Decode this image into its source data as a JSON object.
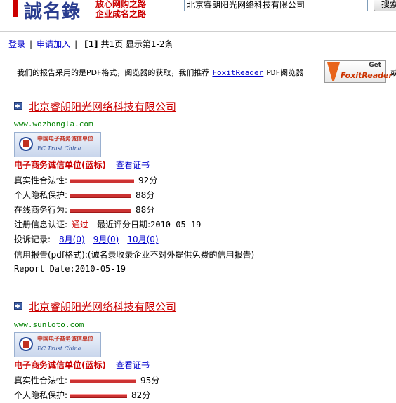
{
  "header": {
    "logo": "誠名錄",
    "slogan_line1": "放心网购之路",
    "slogan_line2": "企业成名之路",
    "search_value": "北京睿朗阳光网络科技有限公司",
    "search_button": "搜索"
  },
  "nav": {
    "login": "登录",
    "apply": "申请加入",
    "page_current": "[1]",
    "page_info": "共1页 显示第1-2条"
  },
  "notice": {
    "text_before": "我们的报告采用的是PDF格式，阅览器的获取，我们推荐",
    "link": "FoxitReader",
    "text_after": "PDF阅览器",
    "edge": "或",
    "foxit_get": "Get",
    "foxit_name": "FoxitReader"
  },
  "entries": [
    {
      "company": "北京睿朗阳光网络科技有限公司",
      "url": "www.wozhongla.com",
      "badge_cn": "中国电子商务诚信单位",
      "badge_en": "EC Trust China",
      "cert_status": "电子商务诚信单位(蓝标)",
      "cert_link": "查看证书",
      "scores": [
        {
          "label": "真实性合法性:",
          "value": "92分",
          "score": 92
        },
        {
          "label": "个人隐私保护:",
          "value": "88分",
          "score": 88
        },
        {
          "label": "在线商务行为:",
          "value": "88分",
          "score": 88
        }
      ],
      "reg_label": "注册信息认证:",
      "reg_status": "通过",
      "eval_label": "最近评分日期:",
      "eval_date": "2010-05-19",
      "complaint_label": "投诉记录:",
      "complaints": [
        "8月(0)",
        "9月(0)",
        "10月(0)"
      ],
      "report_label": "信用报告(pdf格式):",
      "report_text": "(诚名录收录企业不对外提供免费的信用报告)",
      "report_date": "Report Date:2010-05-19"
    },
    {
      "company": "北京睿朗阳光网络科技有限公司",
      "url": "www.sunloto.com",
      "badge_cn": "中国电子商务诚信单位",
      "badge_en": "EC Trust China",
      "cert_status": "电子商务诚信单位(蓝标)",
      "cert_link": "查看证书",
      "scores": [
        {
          "label": "真实性合法性:",
          "value": "95分",
          "score": 95
        },
        {
          "label": "个人隐私保护:",
          "value": "82分",
          "score": 82
        }
      ]
    }
  ]
}
